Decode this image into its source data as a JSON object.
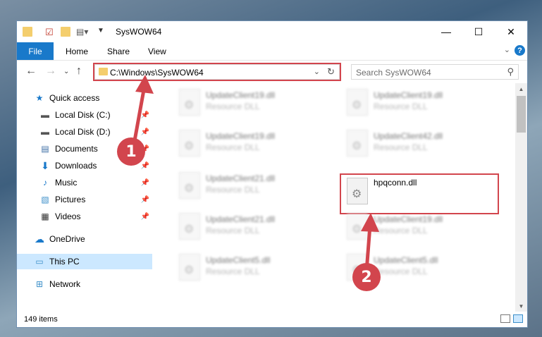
{
  "window": {
    "title": "SysWOW64"
  },
  "ribbon": {
    "file": "File",
    "home": "Home",
    "share": "Share",
    "view": "View",
    "help": "?"
  },
  "nav": {
    "address": "C:\\Windows\\SysWOW64",
    "search_placeholder": "Search SysWOW64"
  },
  "sidebar": {
    "items": [
      {
        "label": "Quick access",
        "icon": "star-icon",
        "pinned": false
      },
      {
        "label": "Local Disk (C:)",
        "icon": "drive-icon",
        "pinned": true
      },
      {
        "label": "Local Disk (D:)",
        "icon": "drive-icon",
        "pinned": true
      },
      {
        "label": "Documents",
        "icon": "documents-icon",
        "pinned": true
      },
      {
        "label": "Downloads",
        "icon": "download-icon",
        "pinned": true
      },
      {
        "label": "Music",
        "icon": "music-icon",
        "pinned": true
      },
      {
        "label": "Pictures",
        "icon": "pictures-icon",
        "pinned": true
      },
      {
        "label": "Videos",
        "icon": "videos-icon",
        "pinned": true
      },
      {
        "label": "OneDrive",
        "icon": "cloud-icon",
        "pinned": false
      },
      {
        "label": "This PC",
        "icon": "computer-icon",
        "pinned": false
      },
      {
        "label": "Network",
        "icon": "network-icon",
        "pinned": false
      }
    ]
  },
  "files": [
    {
      "name": "UpdateClient19.dll",
      "type": "Resource DLL"
    },
    {
      "name": "UpdateClient19.dll",
      "type": "Resource DLL"
    },
    {
      "name": "UpdateClient19.dll",
      "type": "Resource DLL"
    },
    {
      "name": "UpdateClient42.dll",
      "type": "Resource DLL"
    },
    {
      "name": "UpdateClient21.dll",
      "type": "Resource DLL"
    },
    {
      "name": "hpqconn.dll",
      "type": ""
    },
    {
      "name": "UpdateClient21.dll",
      "type": "Resource DLL"
    },
    {
      "name": "UpdateClient19.dll",
      "type": "Resource DLL"
    },
    {
      "name": "UpdateClient5.dll",
      "type": "Resource DLL"
    },
    {
      "name": "UpdateClient5.dll",
      "type": "Resource DLL"
    }
  ],
  "status": {
    "item_count": "149 items"
  },
  "annotations": {
    "step1": "1",
    "step2": "2"
  },
  "colors": {
    "accent": "#1979ca",
    "highlight": "#d2454d",
    "selected": "#cce8ff"
  }
}
